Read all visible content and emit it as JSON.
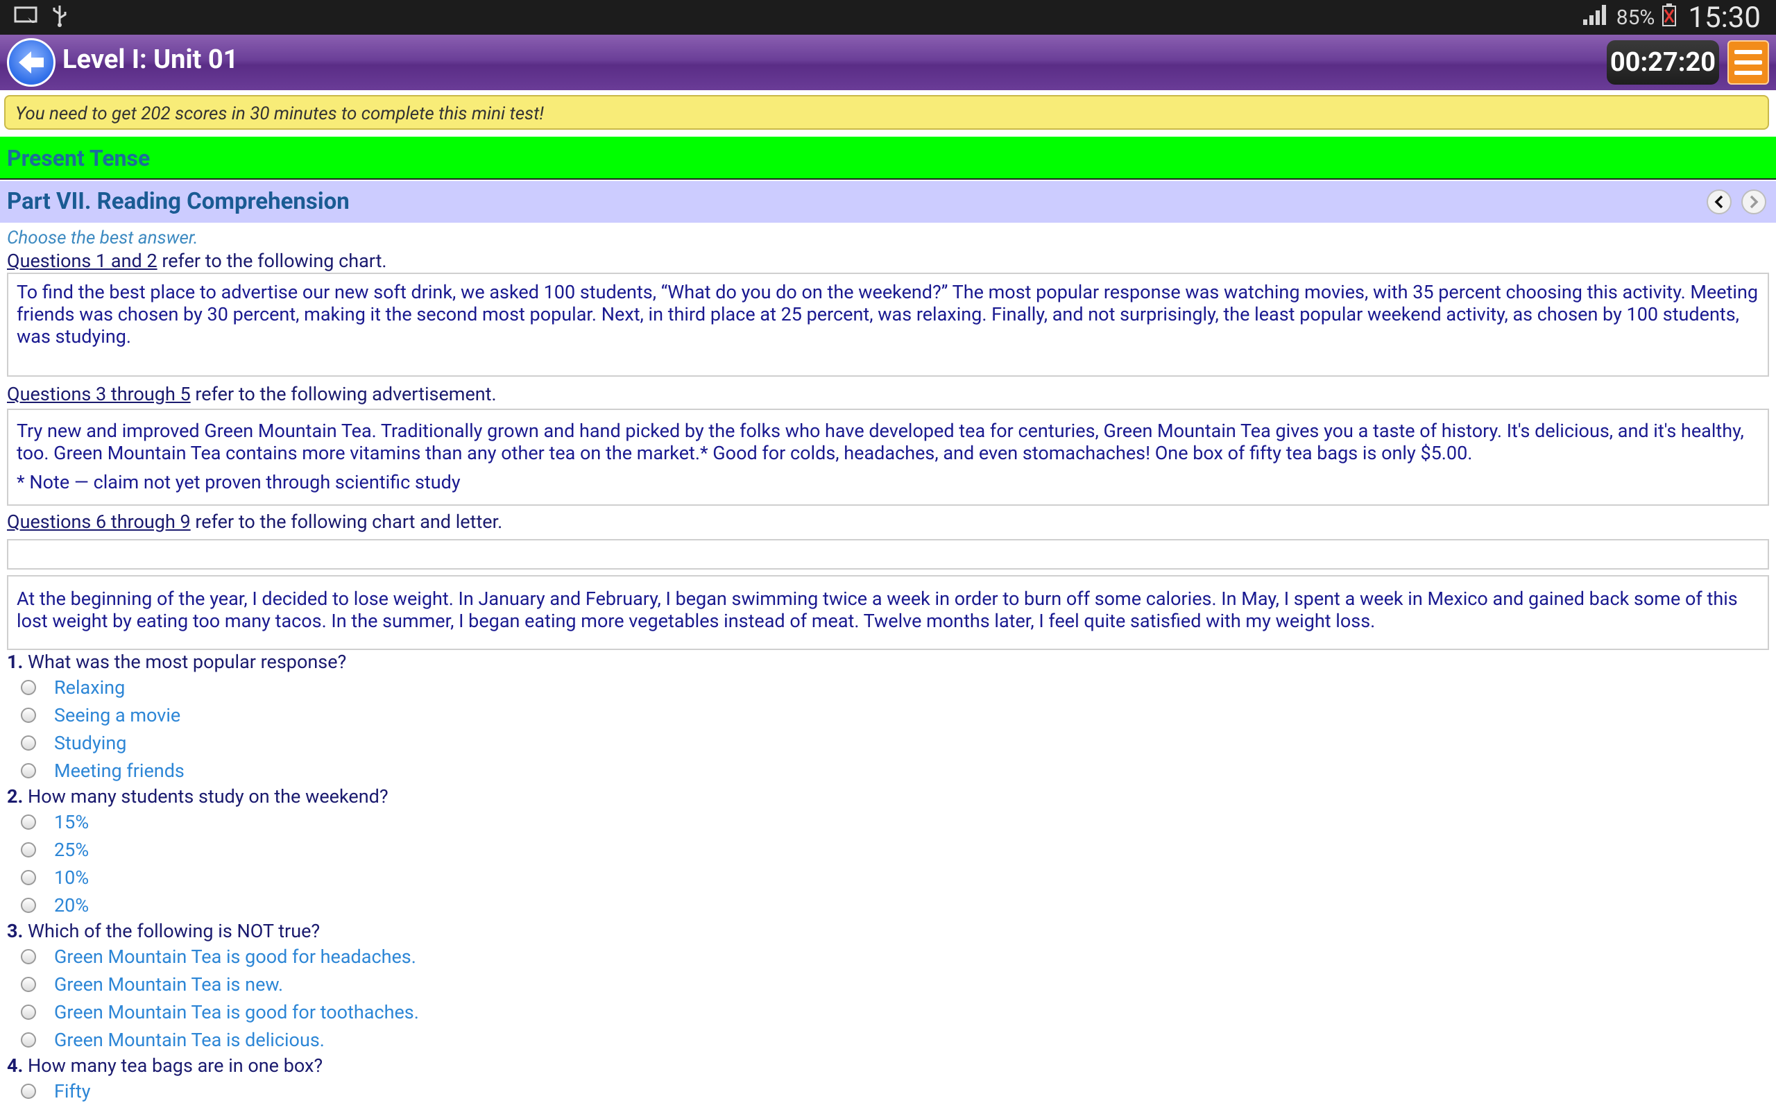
{
  "status_bar": {
    "battery": "85%",
    "time": "15:30"
  },
  "header": {
    "title": "Level I: Unit 01",
    "timer": "00:27:20"
  },
  "notice": "You need to get 202 scores in 30 minutes to complete this mini test!",
  "section_title": "Present Tense",
  "part_title": "Part VII. Reading Comprehension",
  "instructions": "Choose the best answer.",
  "passages": [
    {
      "ref_link": "Questions 1 and 2",
      "ref_rest": " refer to the following chart.",
      "text": "To find the best place to advertise our new soft drink, we asked 100 students, “What do you do on the weekend?” The most popular response was watching movies, with 35 percent choosing this activity. Meeting friends was chosen by 30 percent, making it the second most popular. Next, in third place at 25 percent, was relaxing. Finally, and not surprisingly, the least popular weekend activity, as chosen by 100 students, was studying."
    },
    {
      "ref_link": "Questions 3 through 5",
      "ref_rest": " refer to the following advertisement.",
      "text": "Try new and improved Green Mountain Tea. Traditionally grown and hand picked by the folks who have developed tea for centuries, Green Mountain Tea gives you a taste of history. It's delicious, and it's healthy, too. Green Mountain Tea contains more vitamins than any other tea on the market.* Good for colds, headaches, and even stomachaches! One box of fifty tea bags is only $5.00.",
      "note": "* Note — claim not yet proven through scientific study"
    },
    {
      "ref_link": "Questions 6 through 9",
      "ref_rest": " refer to the following chart and letter.",
      "text": "At the beginning of the year, I decided to lose weight. In January and February, I began swimming twice a week in order to burn off some calories. In May, I spent a week in Mexico and gained back some of this lost weight by eating too many tacos. In the summer, I began eating more vegetables instead of meat. Twelve months later, I feel quite satisfied with my weight loss."
    }
  ],
  "questions": [
    {
      "num": "1.",
      "text": " What was the most popular response?",
      "options": [
        "Relaxing",
        "Seeing a movie",
        "Studying",
        "Meeting friends"
      ]
    },
    {
      "num": "2.",
      "text": " How many students study on the weekend?",
      "options": [
        "15%",
        "25%",
        "10%",
        "20%"
      ]
    },
    {
      "num": "3.",
      "text": " Which of the following is NOT true?",
      "options": [
        "Green Mountain Tea is good for headaches.",
        "Green Mountain Tea is new.",
        "Green Mountain Tea is good for toothaches.",
        "Green Mountain Tea is delicious."
      ]
    },
    {
      "num": "4.",
      "text": " How many tea bags are in one box?",
      "options": [
        "Fifty"
      ]
    }
  ]
}
